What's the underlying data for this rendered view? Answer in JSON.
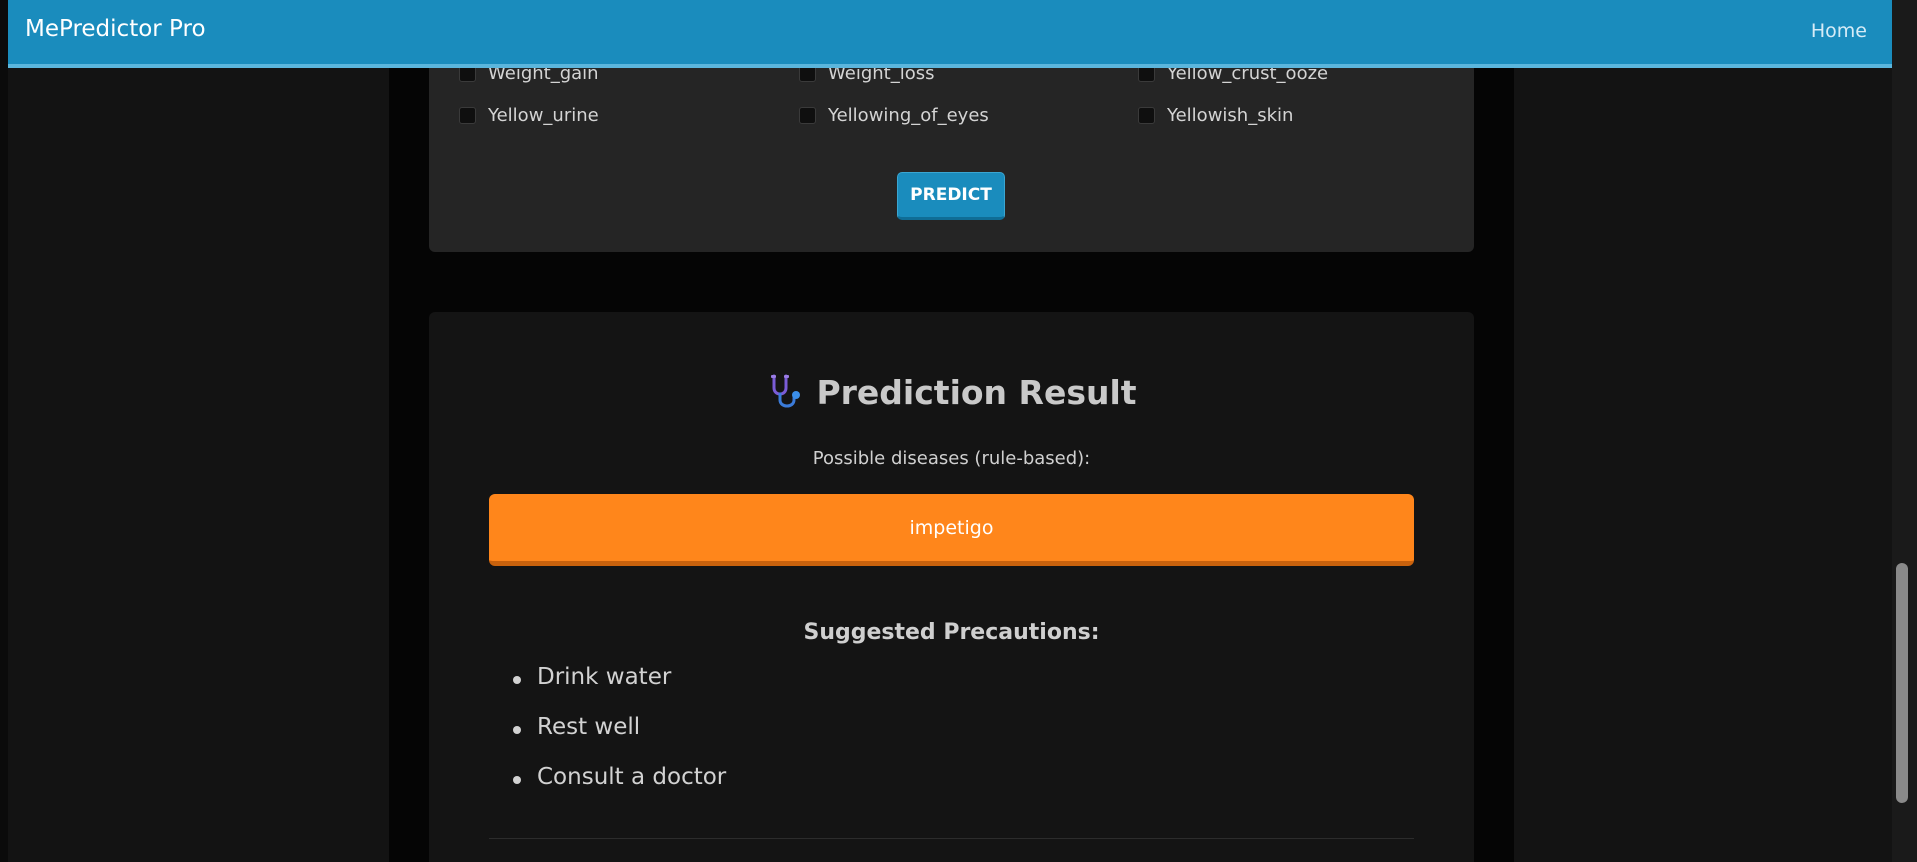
{
  "navbar": {
    "brand": "MePredictor Pro",
    "home_link": "Home"
  },
  "symptoms": {
    "row1": [
      "Weight_gain",
      "Weight_loss",
      "Yellow_crust_ooze"
    ],
    "row2": [
      "Yellow_urine",
      "Yellowing_of_eyes",
      "Yellowish_skin"
    ]
  },
  "predict_button": "PREDICT",
  "result": {
    "icon": "stethoscope-icon",
    "title": "Prediction Result",
    "subtitle": "Possible diseases (rule-based):",
    "diseases": [
      "impetigo"
    ],
    "precautions_title": "Suggested Precautions:",
    "precautions": [
      "Drink water",
      "Rest well",
      "Consult a doctor"
    ]
  },
  "colors": {
    "navbar": "#1a8cbd",
    "disease_bar": "#ff861b",
    "card": "#252525"
  }
}
